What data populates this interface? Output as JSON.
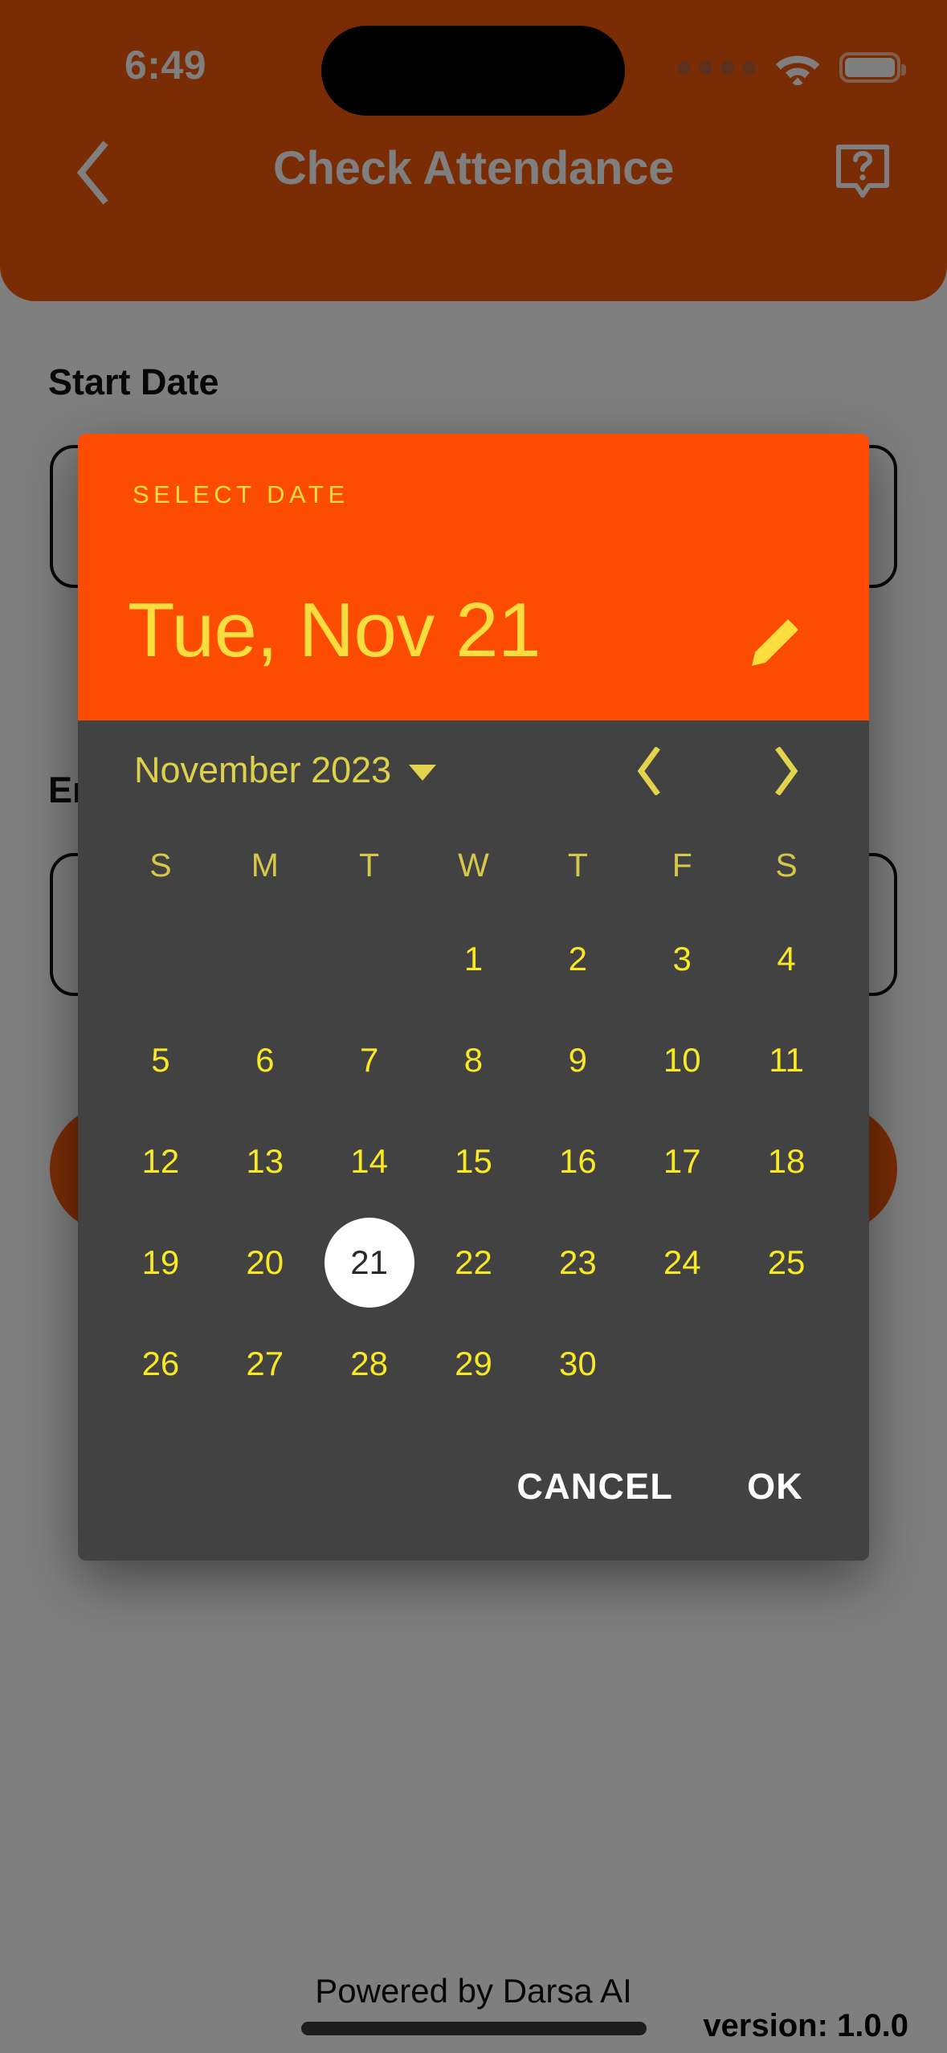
{
  "status_bar": {
    "time": "6:49",
    "signal_icon": "signal-dots-icon",
    "wifi_icon": "wifi-icon",
    "battery_icon": "battery-icon"
  },
  "app_bar": {
    "back_icon": "chevron-left-icon",
    "title": "Check Attendance",
    "help_icon": "help-question-bubble-icon",
    "background_color": "#f45a0a"
  },
  "form": {
    "start_date_label": "Start Date",
    "start_date_value": "",
    "end_date_label": "End Date",
    "end_date_value": ""
  },
  "footer": {
    "powered_by": "Powered by Darsa AI",
    "version": "version: 1.0.0"
  },
  "dialog": {
    "eyebrow": "SELECT DATE",
    "selected_date_text": "Tue, Nov 21",
    "edit_icon": "pencil-edit-icon",
    "header_color": "#fc4c02",
    "accent_text_color": "#fbdd3e",
    "body_color": "#424242",
    "month_label": "November 2023",
    "month_dropdown_icon": "chevron-down-icon",
    "prev_month_icon": "chevron-left-icon",
    "next_month_icon": "chevron-right-icon",
    "weekdays": [
      "S",
      "M",
      "T",
      "W",
      "T",
      "F",
      "S"
    ],
    "weeks": [
      [
        "",
        "",
        "",
        "1",
        "2",
        "3",
        "4"
      ],
      [
        "5",
        "6",
        "7",
        "8",
        "9",
        "10",
        "11"
      ],
      [
        "12",
        "13",
        "14",
        "15",
        "16",
        "17",
        "18"
      ],
      [
        "19",
        "20",
        "21",
        "22",
        "23",
        "24",
        "25"
      ],
      [
        "26",
        "27",
        "28",
        "29",
        "30",
        "",
        ""
      ]
    ],
    "selected_day": "21",
    "cancel_label": "CANCEL",
    "ok_label": "OK"
  }
}
